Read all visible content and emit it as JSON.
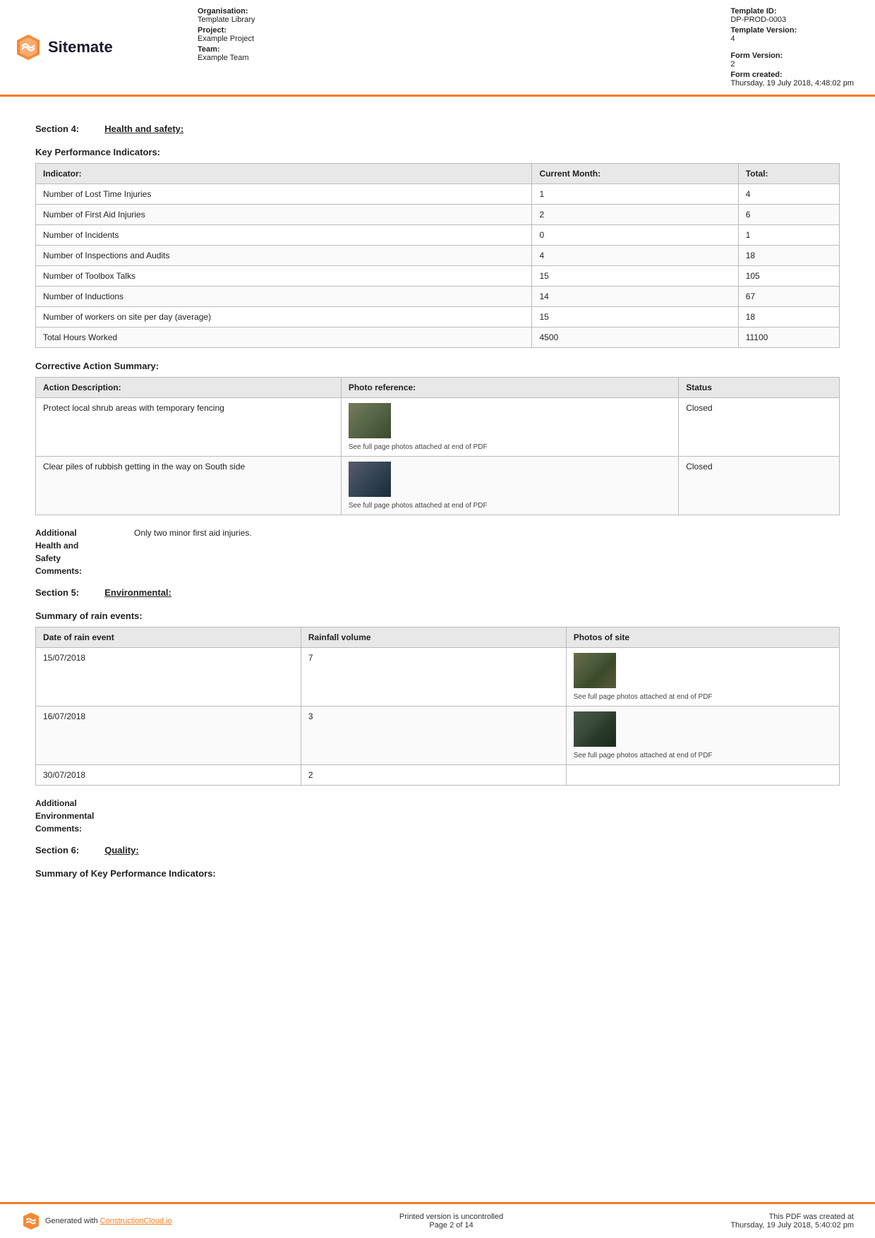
{
  "header": {
    "logo_text": "Sitemate",
    "organisation_label": "Organisation:",
    "organisation_value": "Template Library",
    "project_label": "Project:",
    "project_value": "Example Project",
    "team_label": "Team:",
    "team_value": "Example Team",
    "template_id_label": "Template ID:",
    "template_id_value": "DP-PROD-0003",
    "template_version_label": "Template Version:",
    "template_version_value": "4",
    "form_version_label": "Form Version:",
    "form_version_value": "2",
    "form_created_label": "Form created:",
    "form_created_value": "Thursday, 19 July 2018, 4:48:02 pm"
  },
  "sections": {
    "section4_label": "Section 4:",
    "section4_title": "Health and safety:",
    "section5_label": "Section 5:",
    "section5_title": "Environmental:",
    "section6_label": "Section 6:",
    "section6_title": "Quality:"
  },
  "kpi_table": {
    "heading": "Key Performance Indicators:",
    "columns": [
      "Indicator:",
      "Current Month:",
      "Total:"
    ],
    "rows": [
      [
        "Number of Lost Time Injuries",
        "1",
        "4"
      ],
      [
        "Number of First Aid Injuries",
        "2",
        "6"
      ],
      [
        "Number of Incidents",
        "0",
        "1"
      ],
      [
        "Number of Inspections and Audits",
        "4",
        "18"
      ],
      [
        "Number of Toolbox Talks",
        "15",
        "105"
      ],
      [
        "Number of Inductions",
        "14",
        "67"
      ],
      [
        "Number of workers on site per day (average)",
        "15",
        "18"
      ],
      [
        "Total Hours Worked",
        "4500",
        "11100"
      ]
    ]
  },
  "corrective_action_table": {
    "heading": "Corrective Action Summary:",
    "columns": [
      "Action Description:",
      "Photo reference:",
      "Status"
    ],
    "rows": [
      {
        "action": "Protect local shrub areas with temporary fencing",
        "photo_caption": "See full page photos attached at end of PDF",
        "status": "Closed"
      },
      {
        "action": "Clear piles of rubbish getting in the way on South side",
        "photo_caption": "See full page photos attached at end of PDF",
        "status": "Closed"
      }
    ]
  },
  "additional_health_safety": {
    "label": "Additional\nHealth and\nSafety\nComments:",
    "value": "Only two minor first aid injuries."
  },
  "rain_events_table": {
    "heading": "Summary of rain events:",
    "columns": [
      "Date of rain event",
      "Rainfall volume",
      "Photos of site"
    ],
    "rows": [
      {
        "date": "15/07/2018",
        "volume": "7",
        "photo_caption": "See full page photos attached at end of PDF"
      },
      {
        "date": "16/07/2018",
        "volume": "3",
        "photo_caption": "See full page photos attached at end of PDF"
      },
      {
        "date": "30/07/2018",
        "volume": "2",
        "photo_caption": ""
      }
    ]
  },
  "additional_environmental": {
    "label": "Additional\nEnvironmental\nComments:",
    "value": ""
  },
  "summary_kpi": {
    "heading": "Summary of Key Performance Indicators:"
  },
  "footer": {
    "generated_text": "Generated with",
    "link_text": "ConstructionCloud.io",
    "middle_text": "Printed version is uncontrolled",
    "page_text": "Page 2 of 14",
    "right_text": "This PDF was created at",
    "right_date": "Thursday, 19 July 2018, 5:40:02 pm"
  }
}
